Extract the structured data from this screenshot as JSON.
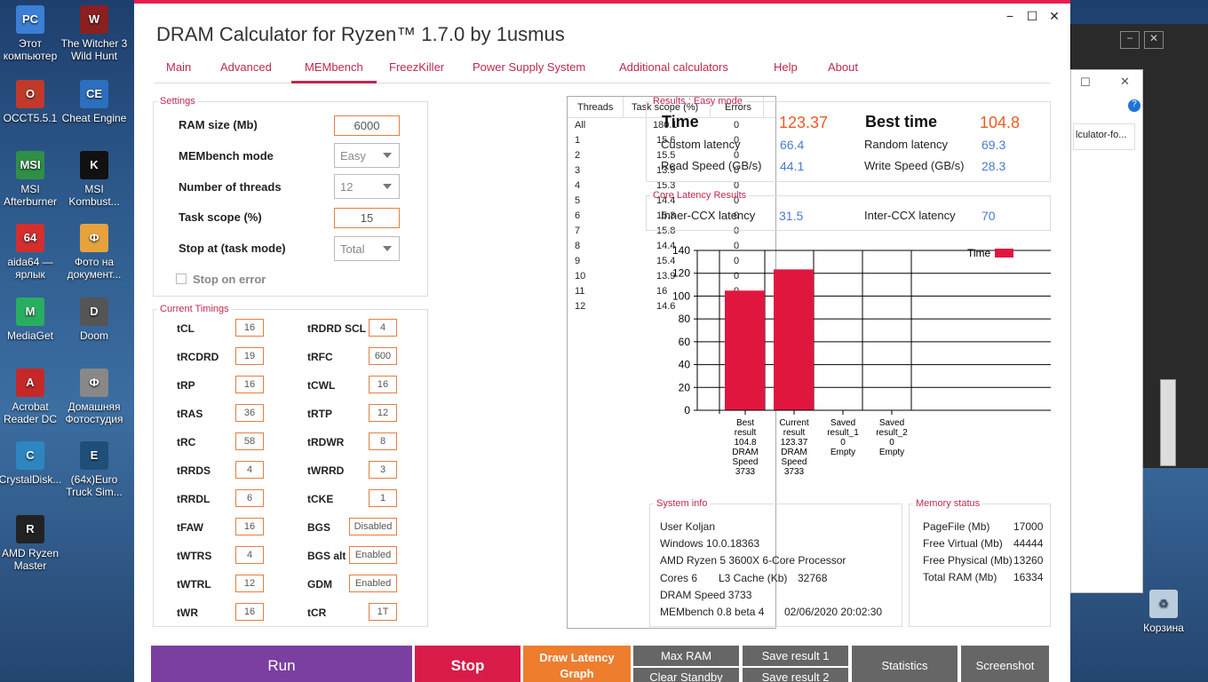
{
  "desktop": {
    "icons": [
      {
        "label": "Этот компьютер",
        "glyph": "PC",
        "color": "#3b7fd6"
      },
      {
        "label": "The Witcher 3 Wild Hunt",
        "glyph": "W",
        "color": "#8a2020"
      },
      {
        "label": "OCCT5.5.1",
        "glyph": "O",
        "color": "#c0392b"
      },
      {
        "label": "Cheat Engine",
        "glyph": "CE",
        "color": "#2c6fbf"
      },
      {
        "label": "MSI Afterburner",
        "glyph": "MSI",
        "color": "#2f8f46"
      },
      {
        "label": "MSI Kombust...",
        "glyph": "K",
        "color": "#111"
      },
      {
        "label": "aida64 — ярлык",
        "glyph": "64",
        "color": "#d32f2f"
      },
      {
        "label": "Фото на документ...",
        "glyph": "Ф",
        "color": "#e6a23c"
      },
      {
        "label": "MediaGet",
        "glyph": "M",
        "color": "#27ae60"
      },
      {
        "label": "Doom",
        "glyph": "D",
        "color": "#555"
      },
      {
        "label": "Acrobat Reader DC",
        "glyph": "A",
        "color": "#c62828"
      },
      {
        "label": "Домашняя Фотостудия",
        "glyph": "Ф",
        "color": "#888"
      },
      {
        "label": "CrystalDisk...",
        "glyph": "C",
        "color": "#2e86c1"
      },
      {
        "label": "(64x)Euro Truck Sim...",
        "glyph": "E",
        "color": "#1f4e79"
      },
      {
        "label": "AMD Ryzen Master",
        "glyph": "R",
        "color": "#222"
      }
    ],
    "recycle": "Корзина",
    "explorer_text": "lculator-fo..."
  },
  "window": {
    "title": "DRAM Calculator for Ryzen™ 1.7.0 by 1usmus",
    "controls": {
      "min": "−",
      "max": "☐",
      "close": "✕"
    },
    "tabs": [
      "Main",
      "Advanced",
      "MEMbench",
      "FreezKiller",
      "Power Supply System",
      "Additional calculators",
      "Help",
      "About"
    ],
    "active_tab": "MEMbench"
  },
  "settings": {
    "legend": "Settings",
    "ram_size_label": "RAM size (Mb)",
    "ram_size": "6000",
    "mode_label": "MEMbench mode",
    "mode": "Easy",
    "threads_label": "Number of threads",
    "threads": "12",
    "scope_label": "Task scope (%)",
    "scope": "15",
    "stop_label": "Stop at (task mode)",
    "stop": "Total",
    "stop_on_error": "Stop on error"
  },
  "timings": {
    "legend": "Current Timings",
    "left": [
      [
        "tCL",
        "16"
      ],
      [
        "tRCDRD",
        "19"
      ],
      [
        "tRP",
        "16"
      ],
      [
        "tRAS",
        "36"
      ],
      [
        "tRC",
        "58"
      ],
      [
        "tRRDS",
        "4"
      ],
      [
        "tRRDL",
        "6"
      ],
      [
        "tFAW",
        "16"
      ],
      [
        "tWTRS",
        "4"
      ],
      [
        "tWTRL",
        "12"
      ],
      [
        "tWR",
        "16"
      ]
    ],
    "right": [
      [
        "tRDRD SCL",
        "4"
      ],
      [
        "tRFC",
        "600"
      ],
      [
        "tCWL",
        "16"
      ],
      [
        "tRTP",
        "12"
      ],
      [
        "tRDWR",
        "8"
      ],
      [
        "tWRRD",
        "3"
      ],
      [
        "tCKE",
        "1"
      ],
      [
        "BGS",
        "Disabled"
      ],
      [
        "BGS alt",
        "Enabled"
      ],
      [
        "GDM",
        "Enabled"
      ],
      [
        "tCR",
        "1T"
      ]
    ]
  },
  "threads_table": {
    "headers": [
      "Threads",
      "Task scope (%)",
      "Errors"
    ],
    "rows": [
      [
        "All",
        "180.1",
        "0"
      ],
      [
        "1",
        "15.6",
        "0"
      ],
      [
        "2",
        "15.5",
        "0"
      ],
      [
        "3",
        "13.9",
        "0"
      ],
      [
        "4",
        "15.3",
        "0"
      ],
      [
        "5",
        "14.4",
        "0"
      ],
      [
        "6",
        "15.3",
        "0"
      ],
      [
        "7",
        "15.8",
        "0"
      ],
      [
        "8",
        "14.4",
        "0"
      ],
      [
        "9",
        "15.4",
        "0"
      ],
      [
        "10",
        "13.9",
        "0"
      ],
      [
        "11",
        "16",
        "0"
      ],
      [
        "12",
        "14.6",
        "0"
      ]
    ]
  },
  "results": {
    "legend": "Results : Easy mode",
    "time_label": "Time",
    "time": "123.37",
    "best_label": "Best time",
    "best": "104.8",
    "custom_latency_label": "Custom latency",
    "custom_latency": "66.4",
    "random_latency_label": "Random latency",
    "random_latency": "69.3",
    "read_label": "Read Speed (GB/s)",
    "read": "44.1",
    "write_label": "Write Speed (GB/s)",
    "write": "28.3"
  },
  "core_latency": {
    "legend": "Core Latency Results",
    "inner_label": "Inner-CCX latency",
    "inner": "31.5",
    "inter_label": "Inter-CCX latency",
    "inter": "70"
  },
  "chart_data": {
    "type": "bar",
    "ylim": [
      0,
      140
    ],
    "yticks": [
      0,
      20,
      40,
      60,
      80,
      100,
      120,
      140
    ],
    "legend": "Time",
    "color": "#e0163f",
    "categories": [
      [
        "Best",
        "result",
        "104.8",
        "DRAM",
        "Speed",
        "3733"
      ],
      [
        "Current",
        "result",
        "123.37",
        "DRAM",
        "Speed",
        "3733"
      ],
      [
        "Saved",
        "result_1",
        "0",
        "Empty"
      ],
      [
        "Saved",
        "result_2",
        "0",
        "Empty"
      ]
    ],
    "values": [
      104.8,
      123.37,
      0,
      0
    ]
  },
  "system_info": {
    "legend": "System info",
    "user": "User Koljan",
    "os": "Windows 10.0.18363",
    "cpu": "AMD Ryzen 5 3600X 6-Core Processor",
    "cores": "Cores 6",
    "l3_label": "L3 Cache (Kb)",
    "l3": "32768",
    "dram": "DRAM Speed 3733",
    "bench": "MEMbench 0.8 beta 4",
    "date": "02/06/2020 20:02:30"
  },
  "memory_status": {
    "legend": "Memory status",
    "rows": [
      [
        "PageFile (Mb)",
        "17000"
      ],
      [
        "Free Virtual (Mb)",
        "44444"
      ],
      [
        "Free Physical (Mb)",
        "13260"
      ],
      [
        "Total RAM (Mb)",
        "16334"
      ]
    ]
  },
  "buttons": {
    "run": "Run",
    "stop": "Stop",
    "draw": "Draw Latency Graph",
    "max_ram": "Max RAM",
    "clear_standby": "Clear Standby",
    "save1": "Save result 1",
    "save2": "Save result 2",
    "statistics": "Statistics",
    "screenshot": "Screenshot",
    "colors": {
      "run": "#7b3fa0",
      "stop": "#d81b48",
      "draw": "#ee7d2e",
      "gray": "#666666"
    }
  }
}
